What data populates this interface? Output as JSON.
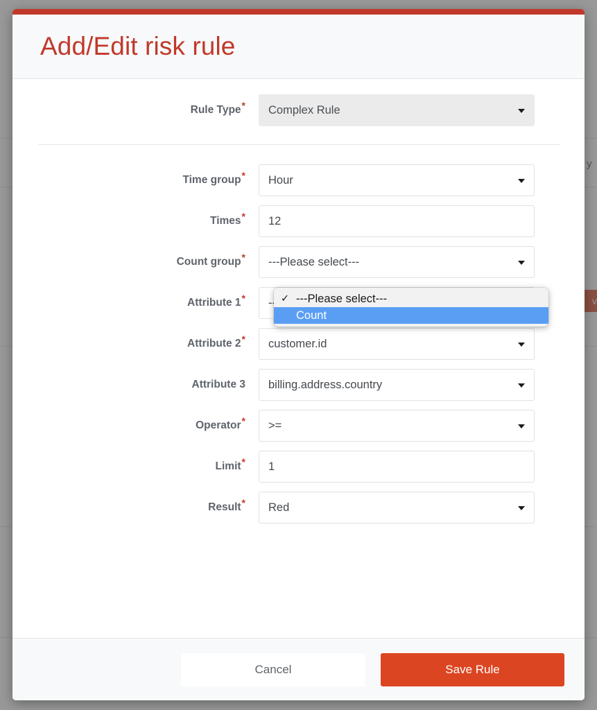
{
  "background": {
    "cell_text_fragment": "y",
    "danger_button_fragment": "ve"
  },
  "modal": {
    "title": "Add/Edit risk rule",
    "accent_color": "#c0392b",
    "rule_type": {
      "label": "Rule Type",
      "required": true,
      "value": "Complex Rule",
      "disabled": true
    },
    "fields": [
      {
        "name": "time-group",
        "label": "Time group",
        "required": true,
        "type": "select",
        "value": "Hour"
      },
      {
        "name": "times",
        "label": "Times",
        "required": true,
        "type": "text",
        "value": "12"
      },
      {
        "name": "count-group",
        "label": "Count group",
        "required": true,
        "type": "select",
        "value": "---Please select---"
      },
      {
        "name": "attribute-1",
        "label": "Attribute 1",
        "required": true,
        "type": "select",
        "value": "---Please select---"
      },
      {
        "name": "attribute-2",
        "label": "Attribute 2",
        "required": true,
        "type": "select",
        "value": "customer.id"
      },
      {
        "name": "attribute-3",
        "label": "Attribute 3",
        "required": false,
        "type": "select",
        "value": "billing.address.country"
      },
      {
        "name": "operator",
        "label": "Operator",
        "required": true,
        "type": "select",
        "value": ">="
      },
      {
        "name": "limit",
        "label": "Limit",
        "required": true,
        "type": "text",
        "value": "1"
      },
      {
        "name": "result",
        "label": "Result",
        "required": true,
        "type": "select",
        "value": "Red"
      }
    ],
    "open_dropdown": {
      "belongs_to": "count-group",
      "options": [
        {
          "label": "---Please select---",
          "selected": true,
          "highlighted": false,
          "check": "✓"
        },
        {
          "label": "Count",
          "selected": false,
          "highlighted": true,
          "check": ""
        }
      ]
    },
    "footer": {
      "cancel_label": "Cancel",
      "save_label": "Save Rule",
      "save_color": "#dc4522"
    }
  }
}
